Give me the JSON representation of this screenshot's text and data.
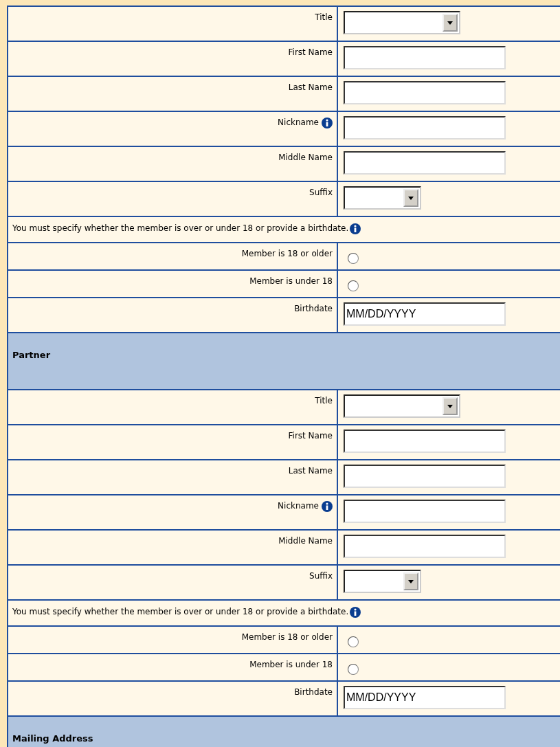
{
  "sections": [
    {
      "rows": [
        {
          "kind": "select",
          "label": "Title"
        },
        {
          "kind": "text",
          "label": "First Name"
        },
        {
          "kind": "text",
          "label": "Last Name"
        },
        {
          "kind": "text",
          "label": "Nickname",
          "info": true
        },
        {
          "kind": "text",
          "label": "Middle Name"
        },
        {
          "kind": "shortselect",
          "label": "Suffix"
        },
        {
          "kind": "note",
          "text": "You must specify whether the member is over or under 18 or provide a birthdate.",
          "info": true
        },
        {
          "kind": "radio",
          "label": "Member is 18 or older",
          "selected": false
        },
        {
          "kind": "radio",
          "label": "Member is under 18",
          "selected": false
        },
        {
          "kind": "text",
          "label": "Birthdate",
          "value": "MM/DD/YYYY"
        }
      ]
    },
    {
      "heading": "Partner",
      "rows": [
        {
          "kind": "select",
          "label": "Title"
        },
        {
          "kind": "text",
          "label": "First Name"
        },
        {
          "kind": "text",
          "label": "Last Name"
        },
        {
          "kind": "text",
          "label": "Nickname",
          "info": true
        },
        {
          "kind": "text",
          "label": "Middle Name"
        },
        {
          "kind": "shortselect",
          "label": "Suffix"
        },
        {
          "kind": "note",
          "text": "You must specify whether the member is over or under 18 or provide a birthdate.",
          "info": true
        },
        {
          "kind": "radio",
          "label": "Member is 18 or older",
          "selected": false
        },
        {
          "kind": "radio",
          "label": "Member is under 18",
          "selected": false
        },
        {
          "kind": "text",
          "label": "Birthdate",
          "value": "MM/DD/YYYY"
        }
      ]
    },
    {
      "heading": "Mailing Address"
    }
  ]
}
